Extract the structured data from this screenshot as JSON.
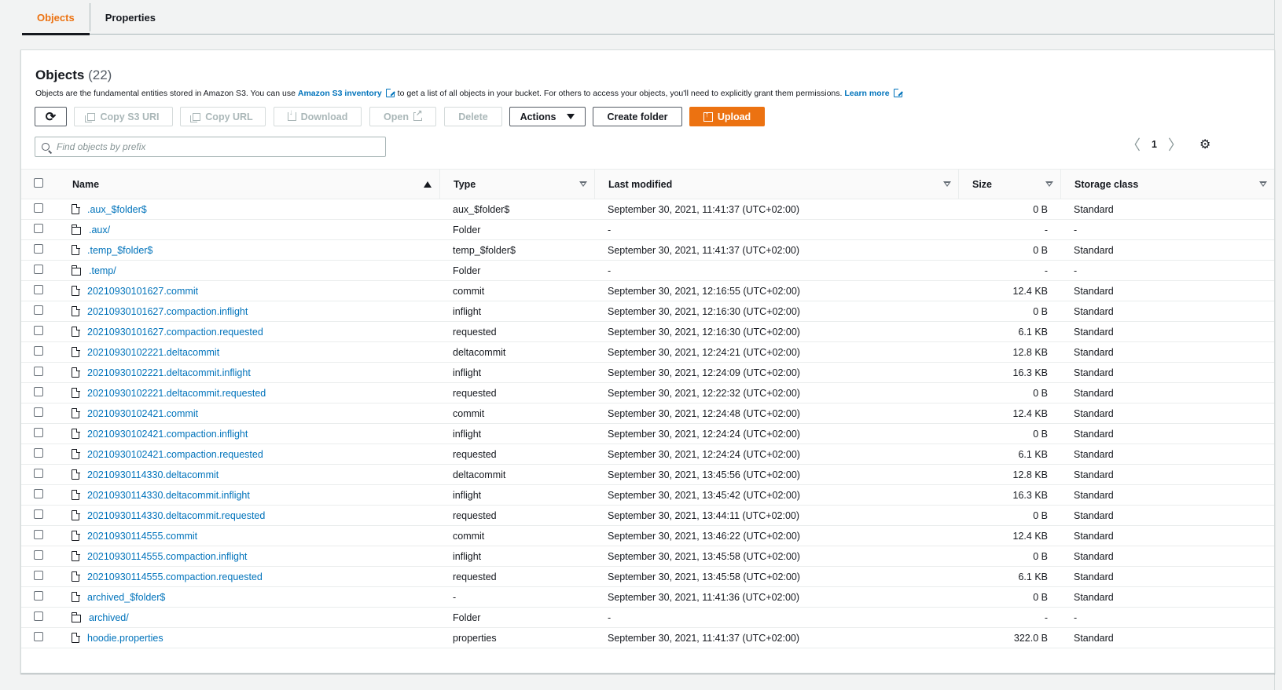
{
  "tabs": [
    {
      "label": "Objects",
      "active": true
    },
    {
      "label": "Properties",
      "active": false
    }
  ],
  "header": {
    "title": "Objects",
    "count": "(22)"
  },
  "description": {
    "part1": "Objects are the fundamental entities stored in Amazon S3. You can use",
    "link1": "Amazon S3 inventory",
    "part2": "to get a list of all objects in your bucket. For others to access your objects, you'll need to explicitly grant them permissions.",
    "link2": "Learn more"
  },
  "toolbar": {
    "copy_s3_uri": "Copy S3 URI",
    "copy_url": "Copy URL",
    "download": "Download",
    "open": "Open",
    "delete": "Delete",
    "actions": "Actions",
    "create_folder": "Create folder",
    "upload": "Upload"
  },
  "search": {
    "placeholder": "Find objects by prefix"
  },
  "pagination": {
    "page": "1"
  },
  "columns": [
    "Name",
    "Type",
    "Last modified",
    "Size",
    "Storage class"
  ],
  "rows": [
    {
      "name": ".aux_$folder$",
      "kind": "file",
      "type": "aux_$folder$",
      "modified": "September 30, 2021, 11:41:37 (UTC+02:00)",
      "size": "0 B",
      "storage": "Standard"
    },
    {
      "name": ".aux/",
      "kind": "folder",
      "type": "Folder",
      "modified": "-",
      "size": "-",
      "storage": "-"
    },
    {
      "name": ".temp_$folder$",
      "kind": "file",
      "type": "temp_$folder$",
      "modified": "September 30, 2021, 11:41:37 (UTC+02:00)",
      "size": "0 B",
      "storage": "Standard"
    },
    {
      "name": ".temp/",
      "kind": "folder",
      "type": "Folder",
      "modified": "-",
      "size": "-",
      "storage": "-"
    },
    {
      "name": "20210930101627.commit",
      "kind": "file",
      "type": "commit",
      "modified": "September 30, 2021, 12:16:55 (UTC+02:00)",
      "size": "12.4 KB",
      "storage": "Standard"
    },
    {
      "name": "20210930101627.compaction.inflight",
      "kind": "file",
      "type": "inflight",
      "modified": "September 30, 2021, 12:16:30 (UTC+02:00)",
      "size": "0 B",
      "storage": "Standard"
    },
    {
      "name": "20210930101627.compaction.requested",
      "kind": "file",
      "type": "requested",
      "modified": "September 30, 2021, 12:16:30 (UTC+02:00)",
      "size": "6.1 KB",
      "storage": "Standard"
    },
    {
      "name": "20210930102221.deltacommit",
      "kind": "file",
      "type": "deltacommit",
      "modified": "September 30, 2021, 12:24:21 (UTC+02:00)",
      "size": "12.8 KB",
      "storage": "Standard"
    },
    {
      "name": "20210930102221.deltacommit.inflight",
      "kind": "file",
      "type": "inflight",
      "modified": "September 30, 2021, 12:24:09 (UTC+02:00)",
      "size": "16.3 KB",
      "storage": "Standard"
    },
    {
      "name": "20210930102221.deltacommit.requested",
      "kind": "file",
      "type": "requested",
      "modified": "September 30, 2021, 12:22:32 (UTC+02:00)",
      "size": "0 B",
      "storage": "Standard"
    },
    {
      "name": "20210930102421.commit",
      "kind": "file",
      "type": "commit",
      "modified": "September 30, 2021, 12:24:48 (UTC+02:00)",
      "size": "12.4 KB",
      "storage": "Standard"
    },
    {
      "name": "20210930102421.compaction.inflight",
      "kind": "file",
      "type": "inflight",
      "modified": "September 30, 2021, 12:24:24 (UTC+02:00)",
      "size": "0 B",
      "storage": "Standard"
    },
    {
      "name": "20210930102421.compaction.requested",
      "kind": "file",
      "type": "requested",
      "modified": "September 30, 2021, 12:24:24 (UTC+02:00)",
      "size": "6.1 KB",
      "storage": "Standard"
    },
    {
      "name": "20210930114330.deltacommit",
      "kind": "file",
      "type": "deltacommit",
      "modified": "September 30, 2021, 13:45:56 (UTC+02:00)",
      "size": "12.8 KB",
      "storage": "Standard"
    },
    {
      "name": "20210930114330.deltacommit.inflight",
      "kind": "file",
      "type": "inflight",
      "modified": "September 30, 2021, 13:45:42 (UTC+02:00)",
      "size": "16.3 KB",
      "storage": "Standard"
    },
    {
      "name": "20210930114330.deltacommit.requested",
      "kind": "file",
      "type": "requested",
      "modified": "September 30, 2021, 13:44:11 (UTC+02:00)",
      "size": "0 B",
      "storage": "Standard"
    },
    {
      "name": "20210930114555.commit",
      "kind": "file",
      "type": "commit",
      "modified": "September 30, 2021, 13:46:22 (UTC+02:00)",
      "size": "12.4 KB",
      "storage": "Standard"
    },
    {
      "name": "20210930114555.compaction.inflight",
      "kind": "file",
      "type": "inflight",
      "modified": "September 30, 2021, 13:45:58 (UTC+02:00)",
      "size": "0 B",
      "storage": "Standard"
    },
    {
      "name": "20210930114555.compaction.requested",
      "kind": "file",
      "type": "requested",
      "modified": "September 30, 2021, 13:45:58 (UTC+02:00)",
      "size": "6.1 KB",
      "storage": "Standard"
    },
    {
      "name": "archived_$folder$",
      "kind": "file",
      "type": "-",
      "modified": "September 30, 2021, 11:41:36 (UTC+02:00)",
      "size": "0 B",
      "storage": "Standard"
    },
    {
      "name": "archived/",
      "kind": "folder",
      "type": "Folder",
      "modified": "-",
      "size": "-",
      "storage": "-"
    },
    {
      "name": "hoodie.properties",
      "kind": "file",
      "type": "properties",
      "modified": "September 30, 2021, 11:41:37 (UTC+02:00)",
      "size": "322.0 B",
      "storage": "Standard"
    }
  ],
  "colors": {
    "accent": "#ec7211",
    "link": "#0073bb"
  },
  "icons": [
    "refresh-icon",
    "copy-icon",
    "download-icon",
    "external-link-icon",
    "caret-down-icon",
    "upload-icon",
    "search-icon",
    "chevron-left-icon",
    "chevron-right-icon",
    "gear-icon",
    "file-icon",
    "folder-icon"
  ]
}
